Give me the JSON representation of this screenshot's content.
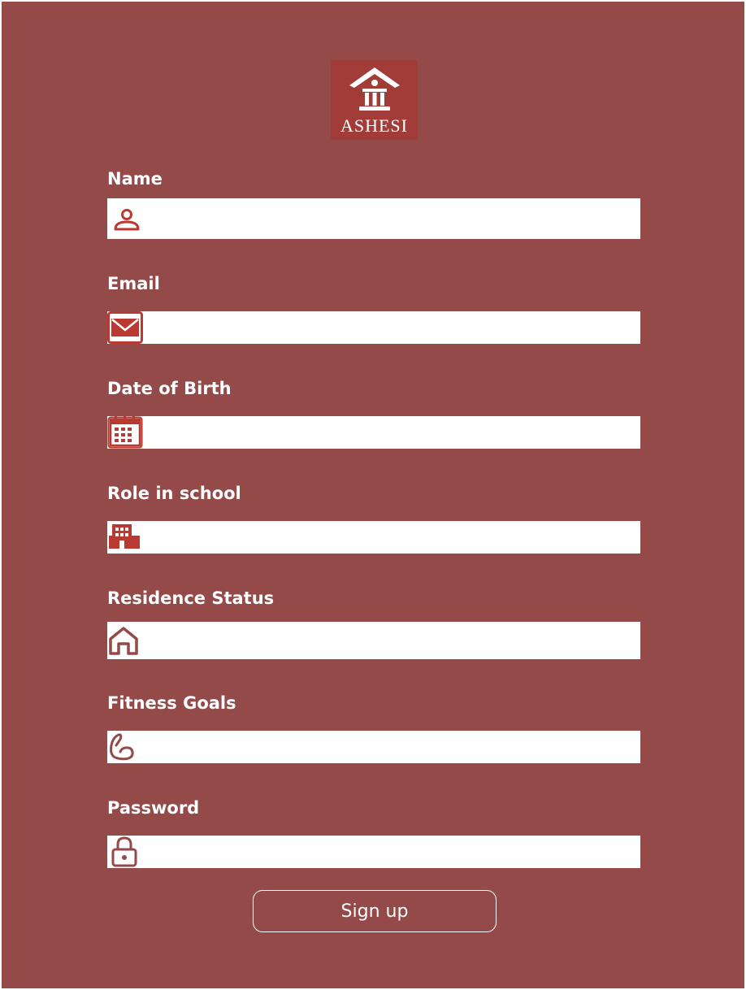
{
  "brand": {
    "name": "ASHESI"
  },
  "fields": [
    {
      "label": "Name",
      "icon": "person-icon",
      "value": ""
    },
    {
      "label": "Email",
      "icon": "envelope-icon",
      "value": ""
    },
    {
      "label": "Date of Birth",
      "icon": "calendar-icon",
      "value": ""
    },
    {
      "label": "Role in school",
      "icon": "building-icon",
      "value": ""
    },
    {
      "label": "Residence Status",
      "icon": "home-icon",
      "value": ""
    },
    {
      "label": "Fitness Goals",
      "icon": "flexed-arm-icon",
      "value": ""
    },
    {
      "label": "Password",
      "icon": "lock-icon",
      "value": ""
    }
  ],
  "signup_button": {
    "label": "Sign up"
  },
  "colors": {
    "background": "#934a49",
    "accent": "#b83a33",
    "logo_bg": "#a23c38"
  }
}
